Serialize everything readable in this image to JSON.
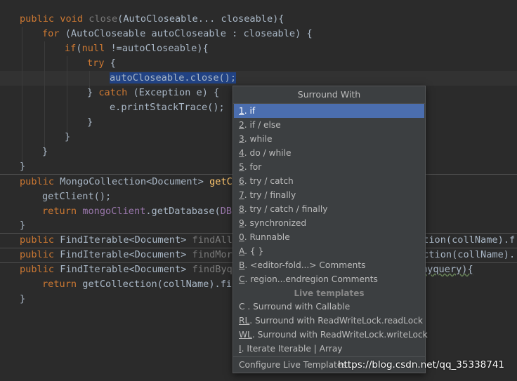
{
  "code": {
    "l1": {
      "kw1": "public",
      "kw2": "void",
      "name": "close",
      "sig": "(AutoCloseable... closeable){"
    },
    "l2": {
      "kw": "for",
      "text": " (AutoCloseable autoCloseable : closeable) {"
    },
    "l3": {
      "kw1": "if",
      "p1": "(",
      "kw2": "null",
      "text": " !=autoCloseable){"
    },
    "l4": {
      "kw": "try",
      "text": " {"
    },
    "l5": {
      "selected": "autoCloseable.close();"
    },
    "l6": {
      "brace": "} ",
      "kw": "catch",
      "text": " (Exception e) {"
    },
    "l7": {
      "text": "e.printStackTrace();"
    },
    "l8": {
      "text": "}"
    },
    "l9": {
      "text": "}"
    },
    "l10": {
      "text": "}"
    },
    "l11": {
      "text": "}"
    },
    "l12": {
      "kw": "public",
      "text": " MongoCollection<Document> ",
      "method": "getCo"
    },
    "l13": {
      "text": "getClient();"
    },
    "l14": {
      "kw": "return",
      "field": "mongoClient",
      "text": ".getDatabase(",
      "field2": "DBN"
    },
    "l15": {
      "text": "}"
    },
    "l16": {
      "kw": "public",
      "text": " FindIterable<Document> ",
      "gray": "findAll(",
      "tail": "ction(collName).f"
    },
    "l17": {
      "kw": "public",
      "text": " FindIterable<Document> ",
      "gray": "findMore",
      "tail": "ection(collName)."
    },
    "l18": {
      "kw": "public",
      "text": " FindIterable<Document> ",
      "gray": "findByqu",
      "tail": "myquery){"
    },
    "l19": {
      "kw": "return",
      "text": " getCollection(collName).fin"
    },
    "l20": {
      "text": "}"
    }
  },
  "popup": {
    "title": "Surround With",
    "items": [
      {
        "mn": "1",
        "label": ". if"
      },
      {
        "mn": "2",
        "label": ". if / else"
      },
      {
        "mn": "3",
        "label": ". while"
      },
      {
        "mn": "4",
        "label": ". do / while"
      },
      {
        "mn": "5",
        "label": ". for"
      },
      {
        "mn": "6",
        "label": ". try / catch"
      },
      {
        "mn": "7",
        "label": ". try / finally"
      },
      {
        "mn": "8",
        "label": ". try / catch / finally"
      },
      {
        "mn": "9",
        "label": ". synchronized"
      },
      {
        "mn": "0",
        "label": ". Runnable"
      },
      {
        "mn": "A",
        "label": ". { }"
      },
      {
        "mn": "B",
        "label": ". <editor-fold...> Comments"
      },
      {
        "mn": "C",
        "label": ". region...endregion Comments"
      }
    ],
    "live_templates_header": "Live templates",
    "templates": [
      {
        "mn": "",
        "label": "C . Surround with Callable"
      },
      {
        "mn": "RL",
        "label": ". Surround with ReadWriteLock.readLock"
      },
      {
        "mn": "WL",
        "label": ". Surround with ReadWriteLock.writeLock"
      },
      {
        "mn": "I",
        "label": ". Iterate Iterable | Array"
      }
    ],
    "configure_label": "Configure Live Templates..."
  },
  "watermark": "https://blog.csdn.net/qq_35338741"
}
